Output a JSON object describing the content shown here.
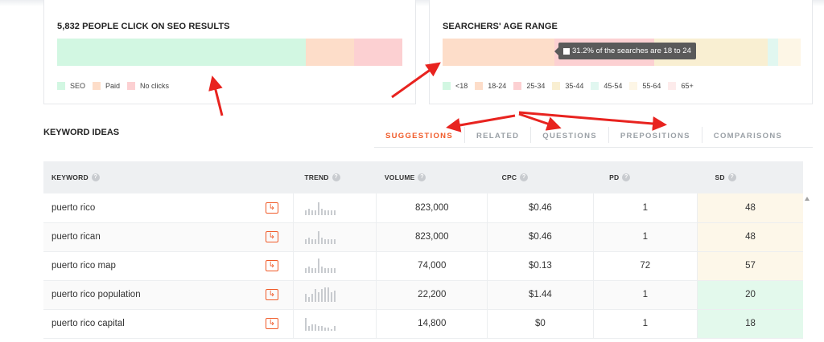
{
  "seo_card": {
    "title": "5,832 PEOPLE CLICK ON SEO RESULTS",
    "segments": [
      {
        "name": "SEO",
        "share": 0.72,
        "color": "#d2f7e2"
      },
      {
        "name": "Paid",
        "share": 0.14,
        "color": "#fdddc9"
      },
      {
        "name": "No clicks",
        "share": 0.14,
        "color": "#fcd0d2"
      }
    ]
  },
  "age_card": {
    "title": "SEARCHERS' AGE RANGE",
    "segments": [
      {
        "name": "<18",
        "share": 0.0,
        "color": "#d2f7e2"
      },
      {
        "name": "18-24",
        "share": 0.312,
        "color": "#fdddc9"
      },
      {
        "name": "25-34",
        "share": 0.28,
        "color": "#fcd0d2"
      },
      {
        "name": "35-44",
        "share": 0.315,
        "color": "#f9efd2"
      },
      {
        "name": "45-54",
        "share": 0.03,
        "color": "#e1f7f0"
      },
      {
        "name": "55-64",
        "share": 0.063,
        "color": "#fdf6e6"
      },
      {
        "name": "65+",
        "share": 0.0,
        "color": "#fdebeb"
      }
    ],
    "tooltip": "31.2% of the searches are 18 to 24"
  },
  "keyword_ideas": {
    "title": "KEYWORD IDEAS",
    "tabs": [
      "SUGGESTIONS",
      "RELATED",
      "QUESTIONS",
      "PREPOSITIONS",
      "COMPARISONS"
    ],
    "active_tab": "SUGGESTIONS"
  },
  "table": {
    "headers": {
      "keyword": "KEYWORD",
      "trend": "TREND",
      "volume": "VOLUME",
      "cpc": "CPC",
      "pd": "PD",
      "sd": "SD"
    },
    "rows": [
      {
        "keyword": "puerto rico",
        "volume": "823,000",
        "cpc": "$0.46",
        "pd": "1",
        "sd": "48",
        "sd_color": "#fdf7e9",
        "trend": [
          3,
          4,
          3,
          3,
          8,
          4,
          3,
          3,
          3,
          3
        ]
      },
      {
        "keyword": "puerto rican",
        "volume": "823,000",
        "cpc": "$0.46",
        "pd": "1",
        "sd": "48",
        "sd_color": "#fdf7e9",
        "trend": [
          3,
          4,
          3,
          3,
          8,
          4,
          3,
          3,
          3,
          3
        ]
      },
      {
        "keyword": "puerto rico map",
        "volume": "74,000",
        "cpc": "$0.13",
        "pd": "72",
        "sd": "57",
        "sd_color": "#fdf7e9",
        "trend": [
          3,
          4,
          3,
          3,
          9,
          4,
          3,
          3,
          3,
          3
        ]
      },
      {
        "keyword": "puerto rico population",
        "volume": "22,200",
        "cpc": "$1.44",
        "pd": "1",
        "sd": "20",
        "sd_color": "#e3f9ec",
        "trend": [
          5,
          3,
          5,
          8,
          6,
          8,
          9,
          9,
          6,
          7
        ]
      },
      {
        "keyword": "puerto rico capital",
        "volume": "14,800",
        "cpc": "$0",
        "pd": "1",
        "sd": "18",
        "sd_color": "#e3f9ec",
        "trend": [
          8,
          3,
          4,
          4,
          3,
          3,
          2,
          2,
          1,
          3
        ]
      }
    ]
  }
}
